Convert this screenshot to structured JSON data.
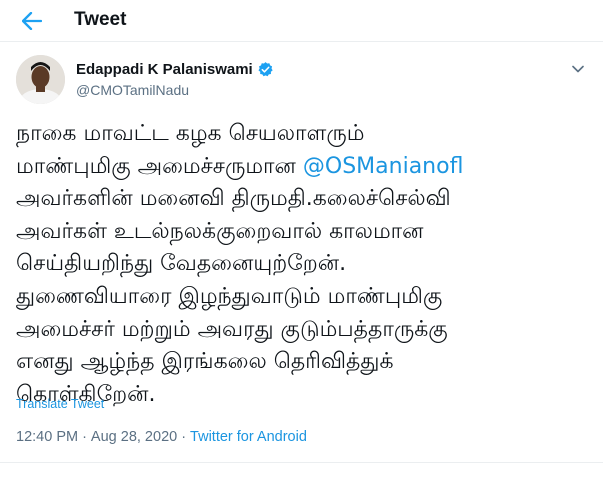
{
  "header": {
    "title": "Tweet",
    "back_icon": "arrow-left-icon"
  },
  "colors": {
    "accent": "#1b95e0",
    "text": "#0f1419",
    "muted": "#5b7083",
    "verified": "#1da1f2"
  },
  "author": {
    "name": "Edappadi K Palaniswami",
    "handle": "@CMOTamilNadu",
    "verified": true,
    "menu_icon": "chevron-down-icon"
  },
  "tweet": {
    "lines": [
      "நாகை மாவட்ட கழக செயலாளரும்",
      "மாண்புமிகு அமைச்சருமான ",
      "அவர்களின் மனைவி திருமதி.கலைச்செல்வி",
      "அவர்கள் உடல்நலக்குறைவால் காலமான",
      "செய்தியறிந்து வேதனையுற்றேன்.",
      "துணைவியாரை இழந்துவாடும் மாண்புமிகு",
      "அமைச்சர் மற்றும் அவரது குடும்பத்தாருக்கு",
      "எனது ஆழ்ந்த இரங்கலை தெரிவித்துக்",
      "கொள்கிறேன்."
    ],
    "mention": "@OSManianofl"
  },
  "translate_label": "Translate Tweet",
  "meta": {
    "time": "12:40 PM",
    "separator": "·",
    "date": "Aug 28, 2020",
    "separator2": "·",
    "source": "Twitter for Android"
  }
}
